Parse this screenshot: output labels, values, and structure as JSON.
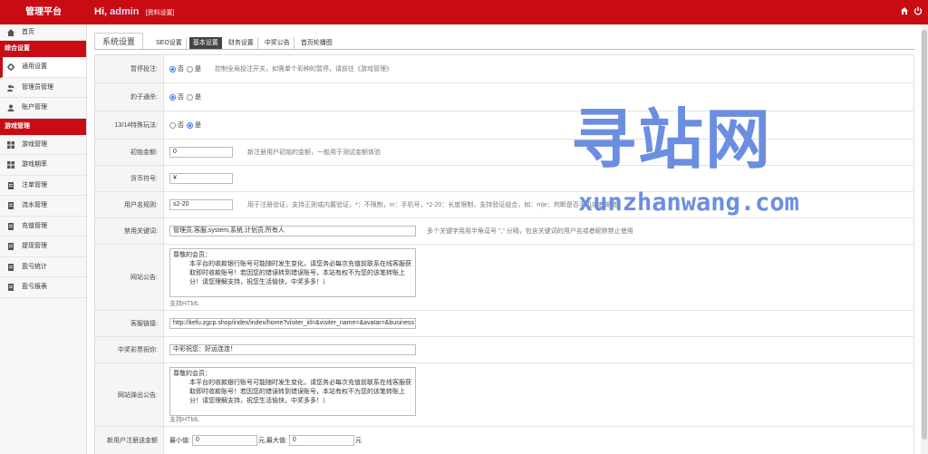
{
  "app": {
    "brand": "管理平台",
    "greet_prefix": "Hi,",
    "user": "admin",
    "profile_link": "[资料设置]"
  },
  "sidebar": {
    "home": "首页",
    "section1": "综合设置",
    "items1": [
      "通用设置",
      "管理员管理",
      "账户管理"
    ],
    "section2": "游戏管理",
    "items2": [
      "游戏管理",
      "游戏期率",
      "注单管理",
      "流水管理",
      "充值管理",
      "提现管理",
      "盈亏统计",
      "盈亏报表"
    ]
  },
  "tabs": [
    "系统设置",
    "SEO设置",
    "基本设置",
    "财务设置",
    "中奖公告",
    "首页轮播图"
  ],
  "form": {
    "pause_bet": {
      "label": "暂停投注:",
      "opt_no": "否",
      "opt_yes": "是",
      "hint": "控制全局投注开关，如需单个彩种的暂停，请前往《游戏管理》"
    },
    "leopard": {
      "label": "豹子通杀:",
      "opt_no": "否",
      "opt_yes": "是"
    },
    "special_13_14": {
      "label": "13/14特殊玩法:",
      "opt_no": "否",
      "opt_yes": "是"
    },
    "init_amount": {
      "label": "初始金额:",
      "value": "0",
      "hint": "新注册用户初始的金额，一般用于测试金额体验"
    },
    "currency": {
      "label": "货币符号:",
      "value": "¥"
    },
    "username_rule": {
      "label": "用户名规则:",
      "value": "s2-20",
      "hint": "用于注册验证，支持正则或内置验证，*：不限制，m：手机号，*2-20：长度限制，支持验证组合，如：m|e：判断是否手机或者邮箱"
    },
    "forbidden_words": {
      "label": "禁用关键词:",
      "value": "管理员,客服,system,系统,计划员,所有人",
      "hint": "多个关键字用用半角逗号 \",\" 分隔，包含关键词的用户名或者昵称禁止使用"
    },
    "site_notice": {
      "label": "网站公告:",
      "line1": "尊敬的会员：",
      "line2": "本平台的收款银行账号可能随时发生变化，请您务必每次充值前联系在线客服获取即时收款账号！若因您的错误转到错误账号，本站有权不为您的该笔转账上分！请您理解支持，祝您生活愉快，中奖多多！）",
      "sub": "支持HTML"
    },
    "service_link": {
      "label": "客服链接:",
      "value": "http://kefu.zgcp.shop/index/index/home?visiter_id=&visiter_name=&avatar=&business"
    },
    "win_wish": {
      "label": "中奖彩票祝你:",
      "value": "中彩祝您：好运连连！"
    },
    "popup_notice": {
      "label": "网站弹出公告:",
      "line1": "尊敬的会员：",
      "line2": "本平台的收款银行账号可能随时发生变化，请您务必每次充值前联系在线客服获取即时收款账号！若因您的错误转到错误账号，本站有权不为您的该笔转账上分！请您理解支持，祝您生活愉快，中奖多多！）",
      "sub": "支持HTML"
    },
    "bonus": {
      "label": "新用户注册送金额",
      "min_label": "最小值:",
      "min_value": "0",
      "max_label": "元,最大值:",
      "max_value": "0",
      "unit": "元"
    }
  },
  "watermark": {
    "chars": "寻站网",
    "url": "xunzhanwang.com"
  },
  "colors": {
    "brand_red": "#c90c14",
    "radio_blue": "#3a7be0",
    "watermark_blue": "#6b8ee0"
  }
}
